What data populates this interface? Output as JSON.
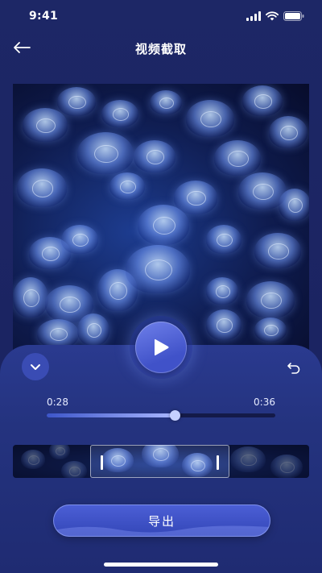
{
  "status_bar": {
    "time": "9:41",
    "icons": [
      "signal-icon",
      "wifi-icon",
      "battery-icon"
    ]
  },
  "header": {
    "title": "视频截取",
    "back_icon": "arrow-left-icon"
  },
  "player": {
    "play_icon": "play-icon",
    "collapse_icon": "chevron-down-icon",
    "undo_icon": "undo-icon"
  },
  "timeline": {
    "start_time": "0:28",
    "end_time": "0:36",
    "progress_fraction": 0.56,
    "selection_start_fraction": 0.26,
    "selection_end_fraction": 0.73
  },
  "actions": {
    "export_label": "导出"
  },
  "colors": {
    "background": "#1b2462",
    "panel": "#2a3a8f",
    "accent": "#4c5fd6",
    "progress_track": "#141a48",
    "progress_fill": "#a9b7ff"
  }
}
